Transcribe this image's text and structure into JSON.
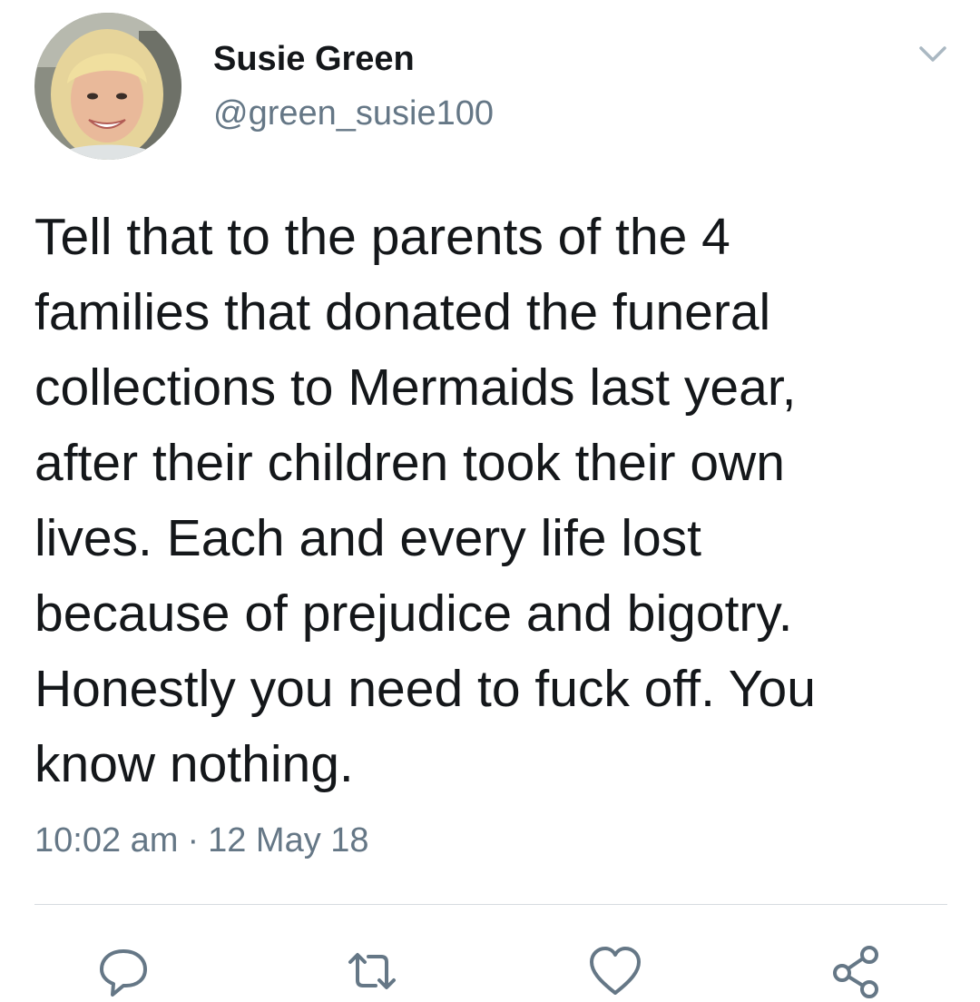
{
  "author": {
    "name": "Susie Green",
    "handle": "@green_susie100",
    "avatar_icon": "profile-photo"
  },
  "tweet": {
    "text": "Tell that to the parents of the 4\nfamilies that donated the funeral\ncollections to Mermaids last year,\nafter their children took their own\nlives. Each and every life lost\nbecause of prejudice and bigotry.\nHonestly you need to fuck off. You\nknow nothing.",
    "time": "10:02 am",
    "separator": "·",
    "date": "12 May 18"
  },
  "actions": [
    {
      "icon": "reply-icon"
    },
    {
      "icon": "retweet-icon"
    },
    {
      "icon": "like-icon"
    },
    {
      "icon": "share-icon"
    }
  ],
  "colors": {
    "text": "#14171a",
    "secondary": "#657786",
    "divider": "#d6dbe0",
    "icon": "#657786"
  }
}
